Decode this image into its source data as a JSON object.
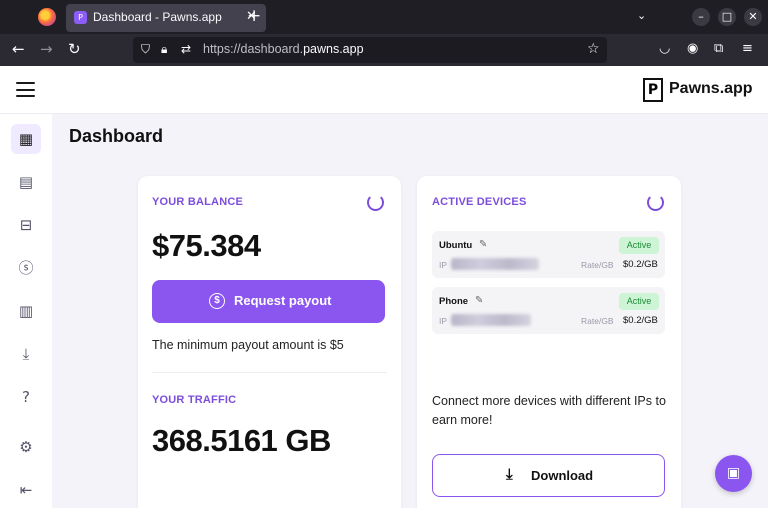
{
  "browser": {
    "tab_title": "Dashboard - Pawns.app",
    "tab_favicon": "P",
    "url_prefix": "https://dashboard.",
    "url_domain": "pawns.app"
  },
  "header": {
    "logo_mark": "P",
    "logo_text": "Pawns.app"
  },
  "page": {
    "title": "Dashboard"
  },
  "balance": {
    "label": "YOUR BALANCE",
    "amount": "$75.384",
    "payout_button": "Request payout",
    "payout_icon": "$",
    "min_note": "The minimum payout amount is $5"
  },
  "traffic": {
    "label": "YOUR TRAFFIC",
    "amount": "368.5161 GB"
  },
  "devices": {
    "label": "ACTIVE DEVICES",
    "items": [
      {
        "name": "Ubuntu",
        "status": "Active",
        "ip_label": "IP",
        "rate_label": "Rate/GB",
        "rate": "$0.2/GB"
      },
      {
        "name": "Phone",
        "status": "Active",
        "ip_label": "IP",
        "rate_label": "Rate/GB",
        "rate": "$0.2/GB"
      }
    ],
    "connect_text": "Connect more devices with different IPs to earn more!",
    "download_button": "Download"
  },
  "colors": {
    "accent": "#8b55f0",
    "label_purple": "#7c4ddb",
    "active_badge_bg": "#cdf4d5",
    "active_badge_text": "#1f8a3a"
  },
  "icons": {
    "sidebar": [
      "dashboard-icon",
      "wallet-icon",
      "gift-icon",
      "dollar-icon",
      "stats-icon",
      "download-icon",
      "help-icon",
      "settings-icon",
      "logout-icon"
    ]
  }
}
